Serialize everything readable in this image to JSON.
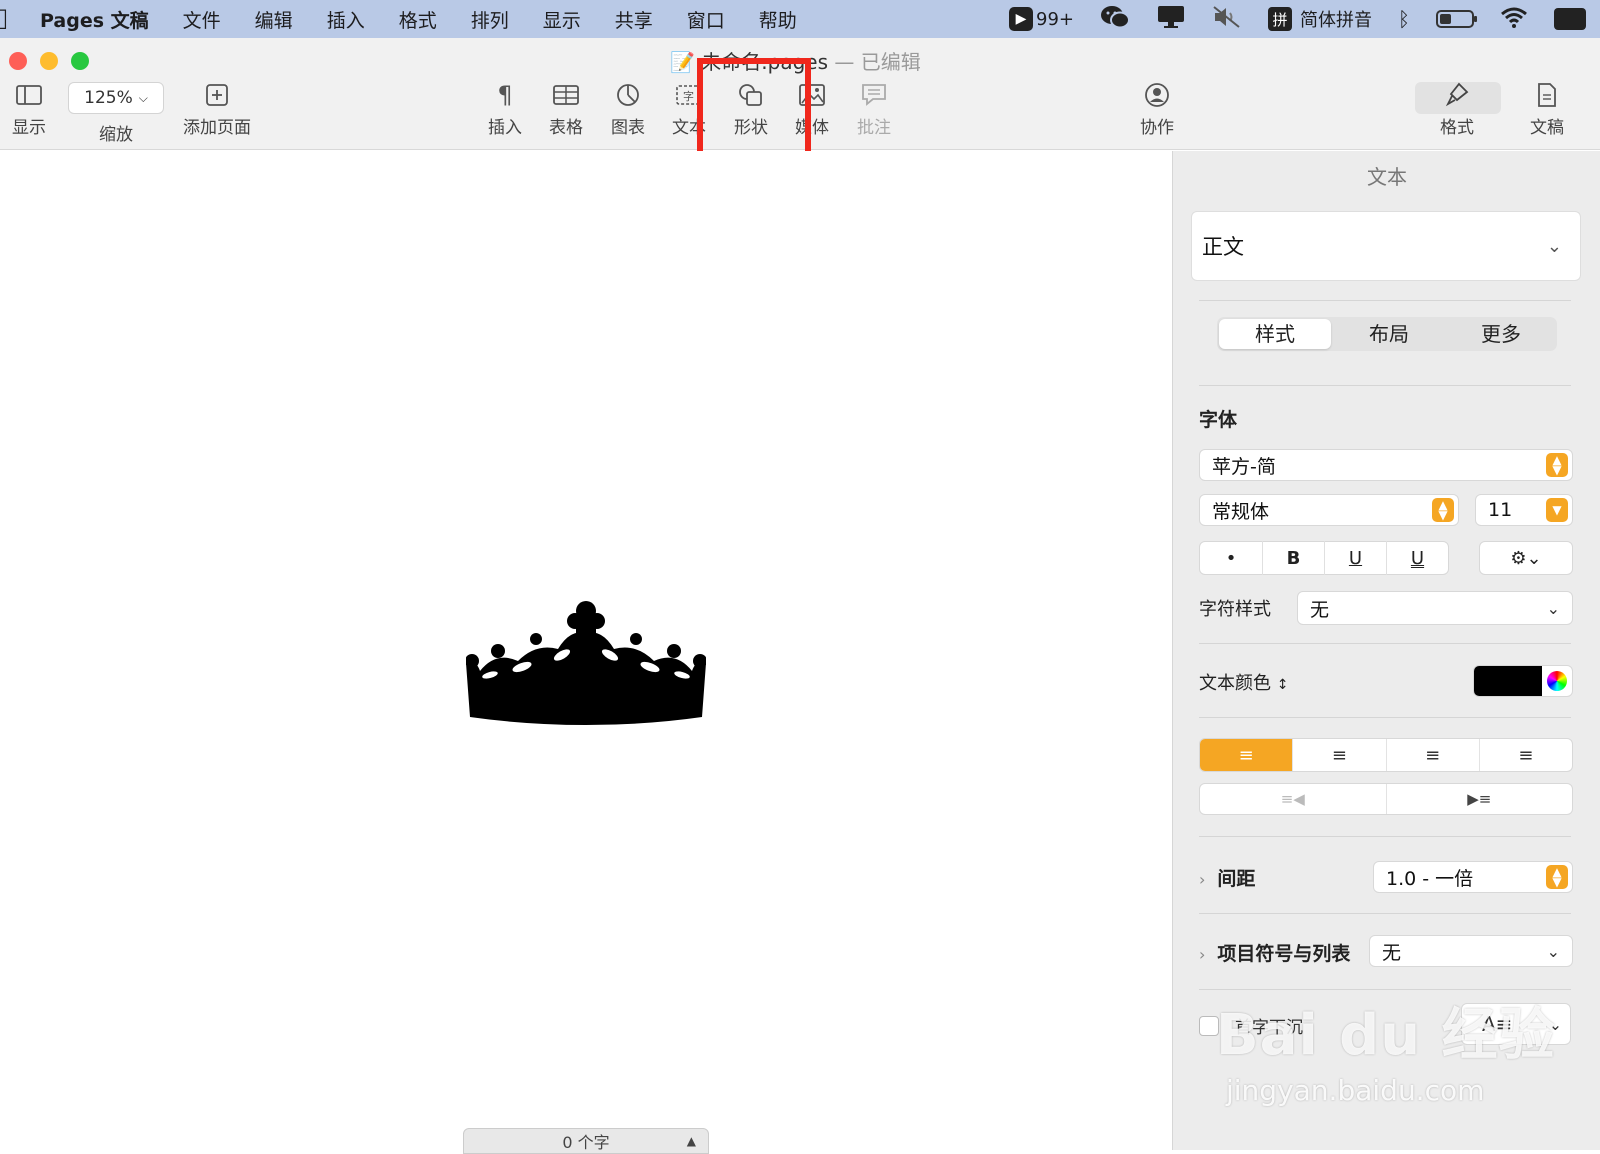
{
  "menubar": {
    "app_name": "Pages 文稿",
    "menus": [
      "文件",
      "编辑",
      "插入",
      "格式",
      "排列",
      "显示",
      "共享",
      "窗口",
      "帮助"
    ],
    "notification_badge": "99+",
    "input_method": "简体拼音",
    "input_method_glyph": "拼"
  },
  "window": {
    "title_name": "未命名.pages",
    "title_sep": "—",
    "title_status": "已编辑"
  },
  "toolbar": {
    "view_label": "显示",
    "zoom_value": "125%",
    "zoom_label": "缩放",
    "add_page_label": "添加页面",
    "insert_label": "插入",
    "table_label": "表格",
    "chart_label": "图表",
    "text_label": "文本",
    "shape_label": "形状",
    "media_label": "媒体",
    "comment_label": "批注",
    "collaborate_label": "协作",
    "format_label": "格式",
    "document_label": "文稿"
  },
  "canvas": {
    "word_count": "0 个字"
  },
  "sidebar": {
    "title": "文本",
    "paragraph_style": "正文",
    "tabs": [
      "样式",
      "布局",
      "更多"
    ],
    "font_section": "字体",
    "font_family": "苹方-简",
    "font_style": "常规体",
    "font_size": "11",
    "style_buttons": [
      "•",
      "B",
      "U",
      "U"
    ],
    "char_style_label": "字符样式",
    "char_style_value": "无",
    "text_color_label": "文本颜色",
    "text_color": "#000000",
    "accent_color": "#f5a623",
    "spacing_label": "间距",
    "spacing_value": "1.0 - 一倍",
    "bullets_label": "项目符号与列表",
    "bullets_value": "无",
    "dropcap_label": "首字下沉"
  },
  "watermark": {
    "brand": "Bai du 经验",
    "url": "jingyan.baidu.com"
  }
}
